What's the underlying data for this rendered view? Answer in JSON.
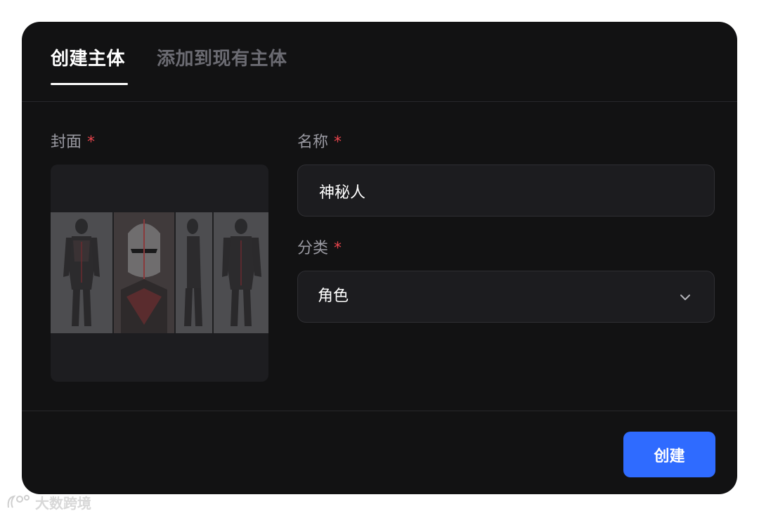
{
  "tabs": [
    {
      "label": "创建主体",
      "active": true
    },
    {
      "label": "添加到现有主体",
      "active": false
    }
  ],
  "form": {
    "cover_label": "封面",
    "name_label": "名称",
    "name_value": "神秘人",
    "category_label": "分类",
    "category_value": "角色",
    "required_mark": "*"
  },
  "cover_image": {
    "alt": "armor character reference sheet",
    "panels": [
      "front-view",
      "head-closeup",
      "side-view",
      "back-view"
    ]
  },
  "actions": {
    "create_label": "创建"
  },
  "watermark": {
    "text": "大数跨境"
  },
  "colors": {
    "accent": "#2f6bff",
    "required": "#e8444c",
    "background": "#121213"
  }
}
